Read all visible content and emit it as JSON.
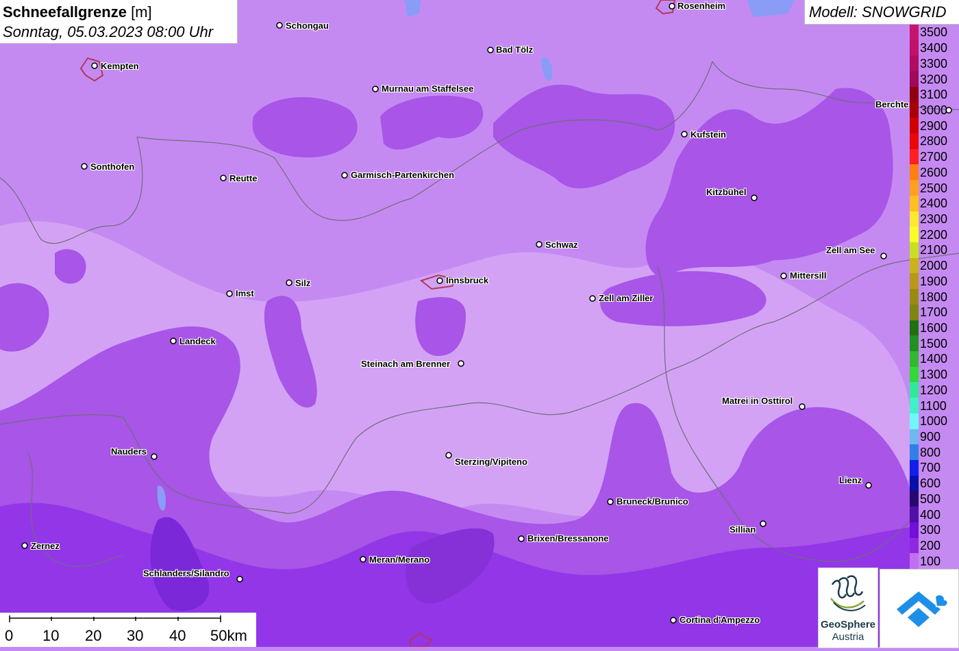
{
  "title": {
    "variable": "Schneefallgrenze",
    "unit": "[m]",
    "datetime": "Sonntag, 05.03.2023 08:00 Uhr"
  },
  "model": "Modell: SNOWGRID",
  "colors": {
    "base": "#c58af2",
    "light": "#d3a2f5",
    "mid": "#a855e8",
    "dark": "#9236e8",
    "deep": "#7a28d8",
    "border": "#6e6e78"
  },
  "legend": {
    "items": [
      {
        "label": "3500",
        "color": "#c8146e"
      },
      {
        "label": "3400",
        "color": "#c0106a"
      },
      {
        "label": "3300",
        "color": "#b00c64"
      },
      {
        "label": "3200",
        "color": "#a0085a"
      },
      {
        "label": "3100",
        "color": "#900010"
      },
      {
        "label": "3000",
        "color": "#a80008"
      },
      {
        "label": "2900",
        "color": "#d00000"
      },
      {
        "label": "2800",
        "color": "#e80808"
      },
      {
        "label": "2700",
        "color": "#ff2020"
      },
      {
        "label": "2600",
        "color": "#ff8010"
      },
      {
        "label": "2500",
        "color": "#ffa020"
      },
      {
        "label": "2400",
        "color": "#ffc020"
      },
      {
        "label": "2300",
        "color": "#ffe830"
      },
      {
        "label": "2200",
        "color": "#f8ff28"
      },
      {
        "label": "2100",
        "color": "#c8e020"
      },
      {
        "label": "2000",
        "color": "#c8b418"
      },
      {
        "label": "1900",
        "color": "#b89818"
      },
      {
        "label": "1800",
        "color": "#988c10"
      },
      {
        "label": "1700",
        "color": "#808410"
      },
      {
        "label": "1600",
        "color": "#207010"
      },
      {
        "label": "1500",
        "color": "#209020"
      },
      {
        "label": "1400",
        "color": "#30b830"
      },
      {
        "label": "1300",
        "color": "#30d838"
      },
      {
        "label": "1200",
        "color": "#30e898"
      },
      {
        "label": "1100",
        "color": "#40f0c8"
      },
      {
        "label": "1000",
        "color": "#70f8f8"
      },
      {
        "label": "900",
        "color": "#70b8f0"
      },
      {
        "label": "800",
        "color": "#3080e8"
      },
      {
        "label": "700",
        "color": "#1020e8"
      },
      {
        "label": "600",
        "color": "#0810a8"
      },
      {
        "label": "500",
        "color": "#280870"
      },
      {
        "label": "400",
        "color": "#5010a8"
      },
      {
        "label": "300",
        "color": "#7010d8"
      },
      {
        "label": "200",
        "color": "#9028e0"
      },
      {
        "label": "100",
        "color": "#c070f0"
      }
    ]
  },
  "cities": [
    {
      "name": "Rosenheim"
    },
    {
      "name": "Schongau"
    },
    {
      "name": "Kempten"
    },
    {
      "name": "Bad Tölz"
    },
    {
      "name": "Murnau am Staffelsee"
    },
    {
      "name": "Berchte"
    },
    {
      "name": "Kufstein"
    },
    {
      "name": "Sonthofen"
    },
    {
      "name": "Reutte"
    },
    {
      "name": "Garmisch-Partenkirchen"
    },
    {
      "name": "Kitzbühel"
    },
    {
      "name": "Schwaz"
    },
    {
      "name": "Zell am See"
    },
    {
      "name": "Mittersill"
    },
    {
      "name": "Innsbruck"
    },
    {
      "name": "Silz"
    },
    {
      "name": "Imst"
    },
    {
      "name": "Zell am Ziller"
    },
    {
      "name": "Landeck"
    },
    {
      "name": "Steinach am Brenner"
    },
    {
      "name": "Matrei in Osttirol"
    },
    {
      "name": "Nauders"
    },
    {
      "name": "Sterzing/Vipiteno"
    },
    {
      "name": "Lienz"
    },
    {
      "name": "Bruneck/Brunico"
    },
    {
      "name": "Sillian"
    },
    {
      "name": "Brixen/Bressanone"
    },
    {
      "name": "Zernez"
    },
    {
      "name": "Meran/Merano"
    },
    {
      "name": "Schlanders/Silandro"
    },
    {
      "name": "Cortina d'Ampezzo"
    }
  ],
  "scale": {
    "labels": [
      "0",
      "10",
      "20",
      "30",
      "40",
      "50km"
    ]
  },
  "logos": {
    "geosphere_line1": "GeoSphere",
    "geosphere_line2": "Austria"
  }
}
